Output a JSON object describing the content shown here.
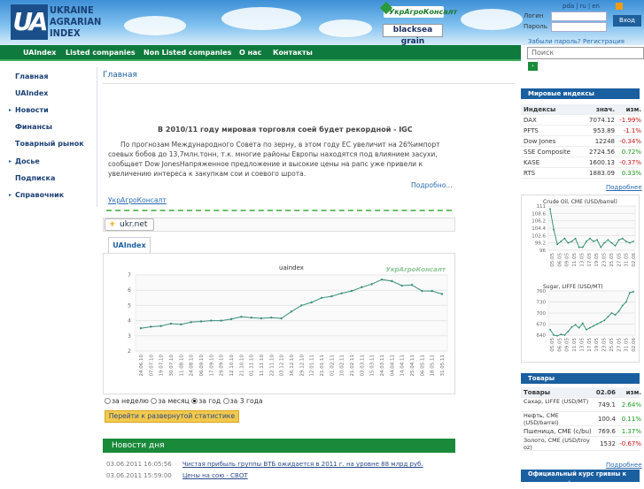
{
  "header": {
    "logo": {
      "abbr": "UA",
      "lines": [
        "UKRAINE",
        "AGRARIAN",
        "INDEX"
      ]
    },
    "partners": [
      "УкрАгроКонсалт",
      "blacksea grain"
    ],
    "langs": [
      "pda",
      "ru",
      "en"
    ],
    "login_label": "Логин",
    "password_label": "Пароль",
    "enter_button": "Вход",
    "forgot_link": "Забыли пароль?",
    "register_link": "Регистрация",
    "search_placeholder": "Поиск"
  },
  "nav": [
    "UAIndex",
    "Listed companies",
    "Non Listed companies",
    "О нас",
    "Контакты"
  ],
  "sidebar": [
    {
      "label": "Главная",
      "arrow": false
    },
    {
      "label": "UAIndex",
      "arrow": false
    },
    {
      "label": "Новости",
      "arrow": true
    },
    {
      "label": "Финансы",
      "arrow": false
    },
    {
      "label": "Товарный рынок",
      "arrow": false
    },
    {
      "label": "Досье",
      "arrow": true
    },
    {
      "label": "Подписка",
      "arrow": false
    },
    {
      "label": "Справочник",
      "arrow": true
    }
  ],
  "page_title": "Главная",
  "news": {
    "title": "В 2010/11 году мировая торговля соей будет рекордной - IGC",
    "body": "По прогнозам Международного Совета по зерну, в этом году ЕС увеличит на  26%импорт соевых бобов до  13,7млн.тонн, т.к. многие районы Европы находятся под влиянием засухи, сообщает  Dow  JonesНапряженное предложение и высокие цены на рапс уже привели к увеличению интереса к закупкам сои и соевого шрота.",
    "more": "Подробно...",
    "source_link": "УкрАгроКонсалт"
  },
  "ukrnet": "ukr.net",
  "tab_label": "UAIndex",
  "chart_data": {
    "type": "line",
    "title": "uaindex",
    "watermark": "УкрАгроКонсалт",
    "ylim": [
      2,
      7
    ],
    "yticks": [
      2,
      3,
      4,
      5,
      6,
      7
    ],
    "categories": [
      "24.06.10",
      "07.07.10",
      "19.07.10",
      "30.07.10",
      "11.08.10",
      "24.08.10",
      "06.09.10",
      "17.09.10",
      "29.09.10",
      "12.10.10",
      "21.10.10",
      "01.11.10",
      "11.11.10",
      "22.11.10",
      "03.12.10",
      "16.12.10",
      "29.12.10",
      "12.01.11",
      "21.01.11",
      "01.02.11",
      "10.02.11",
      "21.02.11",
      "03.03.11",
      "15.03.11",
      "24.03.11",
      "04.04.11",
      "14.04.11",
      "25.04.11",
      "06.05.11",
      "18.05.11",
      "31.05.11"
    ],
    "values": [
      3.5,
      3.6,
      3.65,
      3.8,
      3.75,
      3.9,
      3.95,
      4.0,
      4.0,
      4.1,
      4.25,
      4.2,
      4.15,
      4.2,
      4.15,
      4.6,
      5.0,
      5.2,
      5.5,
      5.6,
      5.8,
      5.95,
      6.2,
      6.4,
      6.7,
      6.6,
      6.3,
      6.35,
      5.95,
      5.95,
      5.75
    ]
  },
  "period_options": [
    "за неделю",
    "за месяц",
    "за год",
    "за 3 года"
  ],
  "period_selected": 2,
  "expand_button": "Перейти к развернутой статистике",
  "day_news": {
    "title": "Новости дня",
    "items": [
      {
        "date": "03.06.2011 16:05:56",
        "text": "Чистая прибыль группы ВТБ ожидается в 2011 г. на уровне 88 млрд руб."
      },
      {
        "date": "03.06.2011 15:59:00",
        "text": "Цены на сою - СВОТ"
      }
    ]
  },
  "world_indices": {
    "title": "Мировые индексы",
    "headers": [
      "Индексы",
      "знач.",
      "изм."
    ],
    "rows": [
      [
        "DAX",
        "7074.12",
        "-1.99%"
      ],
      [
        "PFTS",
        "953.89",
        "-1.1%"
      ],
      [
        "Dow Jones",
        "12248",
        "-0.34%"
      ],
      [
        "SSE Composite",
        "2724.56",
        "0.72%"
      ],
      [
        "KASE",
        "1600.13",
        "-0.37%"
      ],
      [
        "RTS",
        "1883.09",
        "0.33%"
      ]
    ],
    "more": "Подробнее"
  },
  "mini_charts": [
    {
      "title": "Crude Oil, CME (USD/barrel)",
      "yticks": [
        "111",
        "108.6",
        "106.2",
        "104.4",
        "102.6",
        "99.2",
        "96"
      ],
      "dates": [
        "05.05",
        "06.05",
        "09.05",
        "11.05",
        "13.05",
        "17.05",
        "19.05",
        "23.05",
        "25.05",
        "27.05",
        "31.05",
        "02.06"
      ],
      "values": [
        110,
        103,
        98,
        99,
        100,
        98.5,
        99,
        100,
        97,
        97,
        99,
        100,
        99,
        99.5,
        97,
        98.5,
        99.5,
        98.5,
        97.5,
        99.5,
        100,
        99,
        98.5,
        99
      ]
    },
    {
      "title": "Sugar, LIFFE (USD/MT)",
      "yticks": [
        "760",
        "730",
        "700",
        "670",
        "640"
      ],
      "dates": [
        "05.05",
        "06.05",
        "09.05",
        "11.05",
        "13.05",
        "17.05",
        "19.05",
        "23.05",
        "25.05",
        "27.05",
        "31.05",
        "02.06"
      ],
      "values": [
        655,
        640,
        638,
        642,
        640,
        650,
        662,
        668,
        660,
        672,
        655,
        660,
        665,
        670,
        675,
        680,
        690,
        700,
        695,
        705,
        720,
        730,
        755,
        758
      ]
    }
  ],
  "goods": {
    "title": "Товары",
    "headers": [
      "Товары",
      "02.06",
      "изм."
    ],
    "rows": [
      [
        "Сахар, LIFFE (USD/MT)",
        "749.1",
        "2.64%"
      ],
      [
        "Нефть, CME (USD/barrel)",
        "100.4",
        "0.11%"
      ],
      [
        "Пшеница, CME (c/bu)",
        "769.6",
        "1.37%"
      ],
      [
        "Золото, CME (USD/troy oz)",
        "1532",
        "-0.67%"
      ]
    ],
    "more": "Подробнее"
  },
  "official_rate": "Официальный курс гривны к иностранной"
}
